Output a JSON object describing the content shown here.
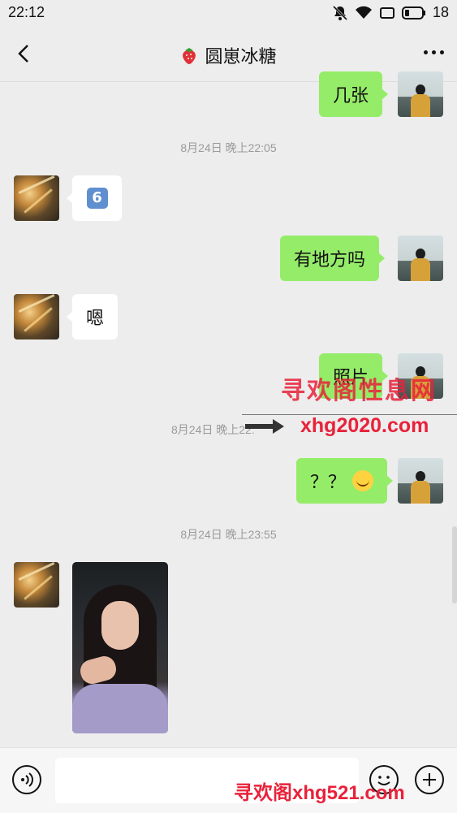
{
  "status_bar": {
    "time": "22:12",
    "battery": "18"
  },
  "header": {
    "title": "圆崽冰糖",
    "title_icon": "strawberry-icon"
  },
  "messages": [
    {
      "from": "me",
      "text": "几张"
    },
    {
      "timestamp": "8月24日 晚上22:05"
    },
    {
      "from": "her",
      "emoji": "6"
    },
    {
      "from": "me",
      "text": "有地方吗"
    },
    {
      "from": "her",
      "text": "嗯"
    },
    {
      "from": "me",
      "text": "照片"
    },
    {
      "timestamp": "8月24日 晚上22:"
    },
    {
      "from": "me",
      "text": "？？"
    },
    {
      "timestamp": "8月24日 晚上23:55"
    },
    {
      "from": "her",
      "type": "image"
    }
  ],
  "watermark": {
    "line1": "寻欢阁性息网",
    "line2": "xhg2020.com",
    "line3": "寻欢阁xhg521.com"
  },
  "colors": {
    "my_bubble": "#95ec69",
    "her_bubble": "#ffffff",
    "background": "#ededed",
    "watermark": "#e8223a"
  }
}
